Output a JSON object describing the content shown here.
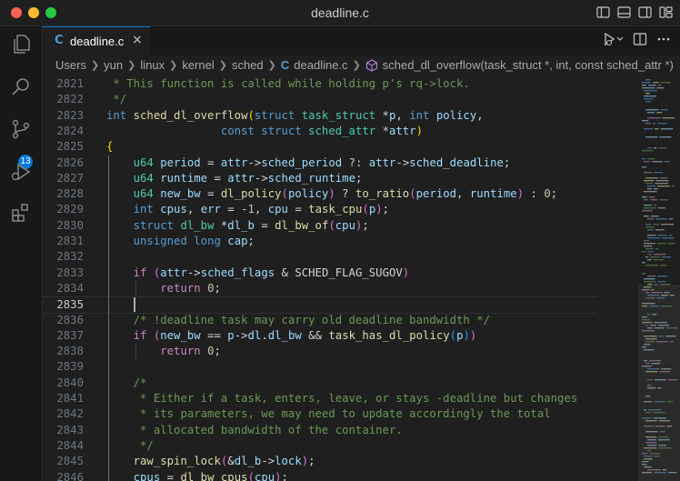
{
  "window": {
    "title": "deadline.c"
  },
  "activity": {
    "scm_badge": "13"
  },
  "tab": {
    "lang": "C",
    "name": "deadline.c",
    "close": "×"
  },
  "breadcrumb": {
    "items": [
      "Users",
      "yun",
      "linux",
      "kernel",
      "sched"
    ],
    "file": "deadline.c",
    "symbol": "sched_dl_overflow(task_struct *, int, const sched_attr *)"
  },
  "editor": {
    "current_line": "2835",
    "lines": [
      {
        "n": "2821",
        "tokens": [
          [
            "cm",
            " * This function is called while holding p's rq->lock."
          ]
        ]
      },
      {
        "n": "2822",
        "tokens": [
          [
            "cm",
            " */"
          ]
        ]
      },
      {
        "n": "2823",
        "tokens": [
          [
            "kw",
            "int"
          ],
          [
            "pl",
            " "
          ],
          [
            "fn",
            "sched_dl_overflow"
          ],
          [
            "br1",
            "("
          ],
          [
            "kw",
            "struct"
          ],
          [
            "pl",
            " "
          ],
          [
            "ty",
            "task_struct"
          ],
          [
            "pl",
            " *"
          ],
          [
            "vr",
            "p"
          ],
          [
            "pl",
            ", "
          ],
          [
            "kw",
            "int"
          ],
          [
            "pl",
            " "
          ],
          [
            "vr",
            "policy"
          ],
          [
            "pl",
            ","
          ]
        ]
      },
      {
        "n": "2824",
        "tokens": [
          [
            "pl",
            "                 "
          ],
          [
            "kw",
            "const"
          ],
          [
            "pl",
            " "
          ],
          [
            "kw",
            "struct"
          ],
          [
            "pl",
            " "
          ],
          [
            "ty",
            "sched_attr"
          ],
          [
            "pl",
            " *"
          ],
          [
            "vr",
            "attr"
          ],
          [
            "br1",
            ")"
          ]
        ]
      },
      {
        "n": "2825",
        "tokens": [
          [
            "br1",
            "{"
          ]
        ]
      },
      {
        "n": "2826",
        "tokens": [
          [
            "pl",
            "    "
          ],
          [
            "ty",
            "u64"
          ],
          [
            "pl",
            " "
          ],
          [
            "vr",
            "period"
          ],
          [
            "pl",
            " = "
          ],
          [
            "vr",
            "attr"
          ],
          [
            "pl",
            "->"
          ],
          [
            "vr",
            "sched_period"
          ],
          [
            "pl",
            " ?: "
          ],
          [
            "vr",
            "attr"
          ],
          [
            "pl",
            "->"
          ],
          [
            "vr",
            "sched_deadline"
          ],
          [
            "pl",
            ";"
          ]
        ]
      },
      {
        "n": "2827",
        "tokens": [
          [
            "pl",
            "    "
          ],
          [
            "ty",
            "u64"
          ],
          [
            "pl",
            " "
          ],
          [
            "vr",
            "runtime"
          ],
          [
            "pl",
            " = "
          ],
          [
            "vr",
            "attr"
          ],
          [
            "pl",
            "->"
          ],
          [
            "vr",
            "sched_runtime"
          ],
          [
            "pl",
            ";"
          ]
        ]
      },
      {
        "n": "2828",
        "tokens": [
          [
            "pl",
            "    "
          ],
          [
            "ty",
            "u64"
          ],
          [
            "pl",
            " "
          ],
          [
            "vr",
            "new_bw"
          ],
          [
            "pl",
            " = "
          ],
          [
            "fn",
            "dl_policy"
          ],
          [
            "br2",
            "("
          ],
          [
            "vr",
            "policy"
          ],
          [
            "br2",
            ")"
          ],
          [
            "pl",
            " ? "
          ],
          [
            "fn",
            "to_ratio"
          ],
          [
            "br2",
            "("
          ],
          [
            "vr",
            "period"
          ],
          [
            "pl",
            ", "
          ],
          [
            "vr",
            "runtime"
          ],
          [
            "br2",
            ")"
          ],
          [
            "pl",
            " : "
          ],
          [
            "nm",
            "0"
          ],
          [
            "pl",
            ";"
          ]
        ]
      },
      {
        "n": "2829",
        "tokens": [
          [
            "pl",
            "    "
          ],
          [
            "kw",
            "int"
          ],
          [
            "pl",
            " "
          ],
          [
            "vr",
            "cpus"
          ],
          [
            "pl",
            ", "
          ],
          [
            "vr",
            "err"
          ],
          [
            "pl",
            " = -"
          ],
          [
            "nm",
            "1"
          ],
          [
            "pl",
            ", "
          ],
          [
            "vr",
            "cpu"
          ],
          [
            "pl",
            " = "
          ],
          [
            "fn",
            "task_cpu"
          ],
          [
            "br2",
            "("
          ],
          [
            "vr",
            "p"
          ],
          [
            "br2",
            ")"
          ],
          [
            "pl",
            ";"
          ]
        ]
      },
      {
        "n": "2830",
        "tokens": [
          [
            "pl",
            "    "
          ],
          [
            "kw",
            "struct"
          ],
          [
            "pl",
            " "
          ],
          [
            "ty",
            "dl_bw"
          ],
          [
            "pl",
            " *"
          ],
          [
            "vr",
            "dl_b"
          ],
          [
            "pl",
            " = "
          ],
          [
            "fn",
            "dl_bw_of"
          ],
          [
            "br2",
            "("
          ],
          [
            "vr",
            "cpu"
          ],
          [
            "br2",
            ")"
          ],
          [
            "pl",
            ";"
          ]
        ]
      },
      {
        "n": "2831",
        "tokens": [
          [
            "pl",
            "    "
          ],
          [
            "kw",
            "unsigned"
          ],
          [
            "pl",
            " "
          ],
          [
            "kw",
            "long"
          ],
          [
            "pl",
            " "
          ],
          [
            "vr",
            "cap"
          ],
          [
            "pl",
            ";"
          ]
        ]
      },
      {
        "n": "2832",
        "tokens": []
      },
      {
        "n": "2833",
        "tokens": [
          [
            "pl",
            "    "
          ],
          [
            "mc",
            "if"
          ],
          [
            "pl",
            " "
          ],
          [
            "br2",
            "("
          ],
          [
            "vr",
            "attr"
          ],
          [
            "pl",
            "->"
          ],
          [
            "vr",
            "sched_flags"
          ],
          [
            "pl",
            " & SCHED_FLAG_SUGOV"
          ],
          [
            "br2",
            ")"
          ]
        ]
      },
      {
        "n": "2834",
        "tokens": [
          [
            "pl",
            "        "
          ],
          [
            "mc",
            "return"
          ],
          [
            "pl",
            " "
          ],
          [
            "nm",
            "0"
          ],
          [
            "pl",
            ";"
          ]
        ]
      },
      {
        "n": "2835",
        "tokens": []
      },
      {
        "n": "2836",
        "tokens": [
          [
            "pl",
            "    "
          ],
          [
            "cm",
            "/* !deadline task may carry old deadline bandwidth */"
          ]
        ]
      },
      {
        "n": "2837",
        "tokens": [
          [
            "pl",
            "    "
          ],
          [
            "mc",
            "if"
          ],
          [
            "pl",
            " "
          ],
          [
            "br2",
            "("
          ],
          [
            "vr",
            "new_bw"
          ],
          [
            "pl",
            " == "
          ],
          [
            "vr",
            "p"
          ],
          [
            "pl",
            "->"
          ],
          [
            "vr",
            "dl"
          ],
          [
            "pl",
            "."
          ],
          [
            "vr",
            "dl_bw"
          ],
          [
            "pl",
            " && "
          ],
          [
            "fn",
            "task_has_dl_policy"
          ],
          [
            "br3",
            "("
          ],
          [
            "vr",
            "p"
          ],
          [
            "br3",
            ")"
          ],
          [
            "br2",
            ")"
          ]
        ]
      },
      {
        "n": "2838",
        "tokens": [
          [
            "pl",
            "        "
          ],
          [
            "mc",
            "return"
          ],
          [
            "pl",
            " "
          ],
          [
            "nm",
            "0"
          ],
          [
            "pl",
            ";"
          ]
        ]
      },
      {
        "n": "2839",
        "tokens": []
      },
      {
        "n": "2840",
        "tokens": [
          [
            "pl",
            "    "
          ],
          [
            "cm",
            "/*"
          ]
        ]
      },
      {
        "n": "2841",
        "tokens": [
          [
            "pl",
            "    "
          ],
          [
            "cm",
            " * Either if a task, enters, leave, or stays -deadline but changes"
          ]
        ]
      },
      {
        "n": "2842",
        "tokens": [
          [
            "pl",
            "    "
          ],
          [
            "cm",
            " * its parameters, we may need to update accordingly the total"
          ]
        ]
      },
      {
        "n": "2843",
        "tokens": [
          [
            "pl",
            "    "
          ],
          [
            "cm",
            " * allocated bandwidth of the container."
          ]
        ]
      },
      {
        "n": "2844",
        "tokens": [
          [
            "pl",
            "    "
          ],
          [
            "cm",
            " */"
          ]
        ]
      },
      {
        "n": "2845",
        "tokens": [
          [
            "pl",
            "    "
          ],
          [
            "fn",
            "raw_spin_lock"
          ],
          [
            "br2",
            "("
          ],
          [
            "pl",
            "&"
          ],
          [
            "vr",
            "dl_b"
          ],
          [
            "pl",
            "->"
          ],
          [
            "vr",
            "lock"
          ],
          [
            "br2",
            ")"
          ],
          [
            "pl",
            ";"
          ]
        ]
      },
      {
        "n": "2846",
        "tokens": [
          [
            "pl",
            "    "
          ],
          [
            "vr",
            "cpus"
          ],
          [
            "pl",
            " = "
          ],
          [
            "fn",
            "dl_bw_cpus"
          ],
          [
            "br2",
            "("
          ],
          [
            "vr",
            "cpu"
          ],
          [
            "br2",
            ")"
          ],
          [
            "pl",
            ";"
          ]
        ]
      }
    ]
  }
}
